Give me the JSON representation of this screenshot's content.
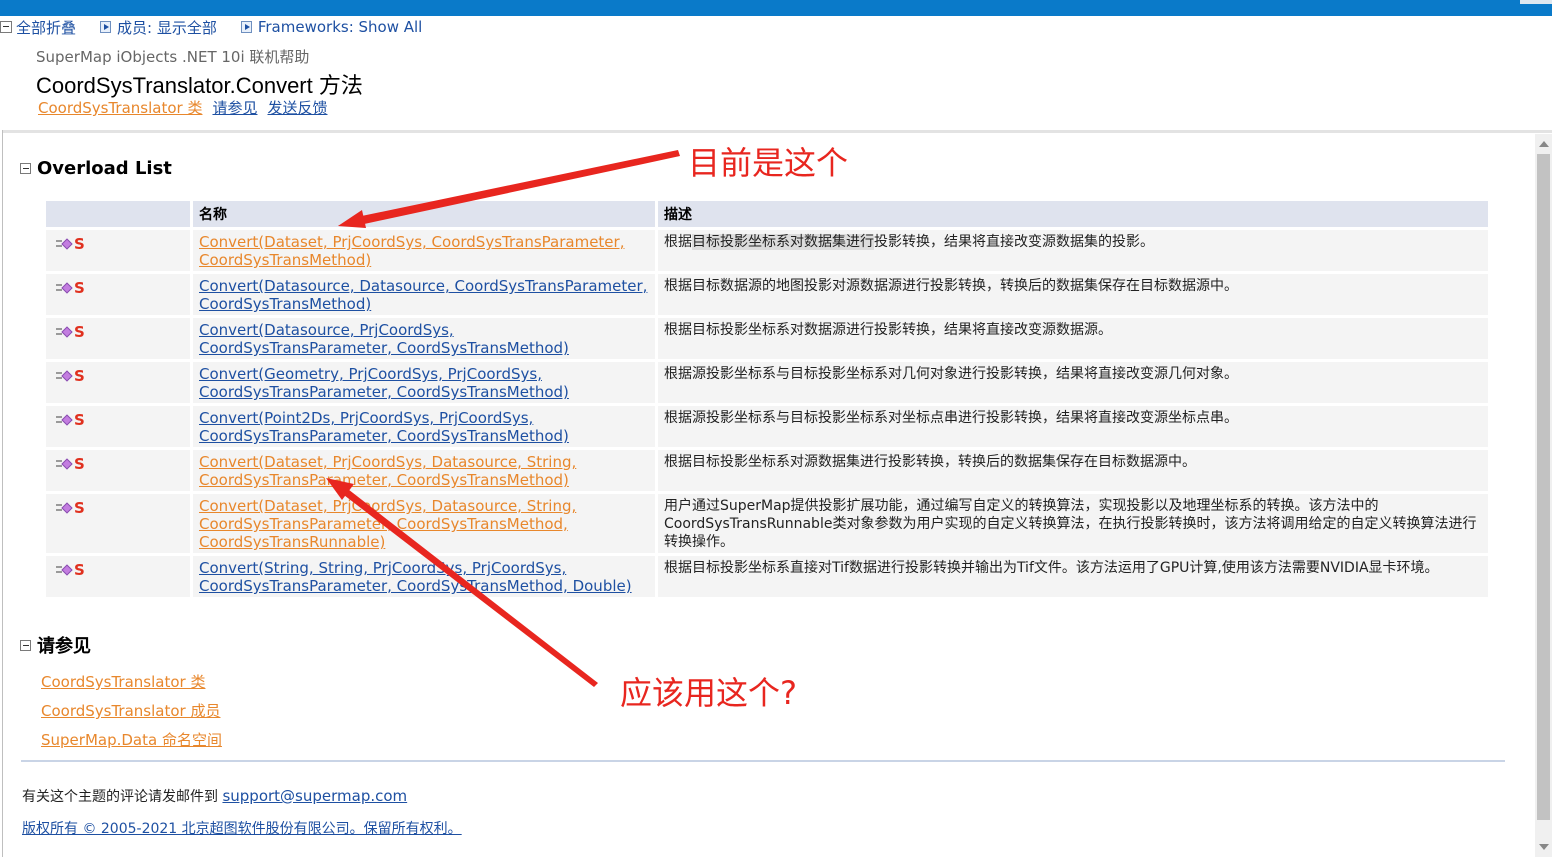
{
  "toolbar": {
    "collapse_all": "全部折叠",
    "members": "成员: 显示全部",
    "frameworks": "Frameworks: Show All"
  },
  "header": {
    "product": "SuperMap iObjects .NET 10i 联机帮助",
    "title": "CoordSysTranslator.Convert 方法",
    "links": [
      "CoordSysTranslator 类",
      "请参见",
      "发送反馈"
    ]
  },
  "overload_section": {
    "title": "Overload List",
    "col_name": "名称",
    "col_desc": "描述",
    "rows": [
      {
        "name_lines": [
          "Convert(Dataset, PrjCoordSys, CoordSysTransParameter,",
          "CoordSysTransMethod)"
        ],
        "visited": true,
        "desc_before": "根据",
        "desc_highlight": "目标投影坐标系对数据集进行",
        "desc_after": "投影转换，结果将直接改变源数据集的投影。"
      },
      {
        "name_lines": [
          "Convert(Datasource, Datasource, CoordSysTransParameter,",
          "CoordSysTransMethod)"
        ],
        "visited": false,
        "desc_before": "根据目标数据源的地图投影对源数据源进行投影转换，转换后的数据集保存在目标数据源中。",
        "desc_highlight": "",
        "desc_after": ""
      },
      {
        "name_lines": [
          "Convert(Datasource, PrjCoordSys,",
          "CoordSysTransParameter, CoordSysTransMethod)"
        ],
        "visited": false,
        "desc_before": "根据目标投影坐标系对数据源进行投影转换，结果将直接改变源数据源。",
        "desc_highlight": "",
        "desc_after": ""
      },
      {
        "name_lines": [
          "Convert(Geometry, PrjCoordSys, PrjCoordSys,",
          "CoordSysTransParameter, CoordSysTransMethod)"
        ],
        "visited": false,
        "desc_before": "根据源投影坐标系与目标投影坐标系对几何对象进行投影转换，结果将直接改变源几何对象。",
        "desc_highlight": "",
        "desc_after": ""
      },
      {
        "name_lines": [
          "Convert(Point2Ds, PrjCoordSys, PrjCoordSys,",
          "CoordSysTransParameter, CoordSysTransMethod)"
        ],
        "visited": false,
        "desc_before": "根据源投影坐标系与目标投影坐标系对坐标点串进行投影转换，结果将直接改变源坐标点串。",
        "desc_highlight": "",
        "desc_after": ""
      },
      {
        "name_lines": [
          "Convert(Dataset, PrjCoordSys, Datasource, String,",
          "CoordSysTransParameter, CoordSysTransMethod)"
        ],
        "visited": true,
        "desc_before": "根据目标投影坐标系对源数据集进行投影转换，转换后的数据集保存在目标数据源中。",
        "desc_highlight": "",
        "desc_after": ""
      },
      {
        "name_lines": [
          "Convert(Dataset, PrjCoordSys, Datasource, String,",
          "CoordSysTransParameter, CoordSysTransMethod,",
          "CoordSysTransRunnable)"
        ],
        "visited": true,
        "desc_before": "用户通过SuperMap提供投影扩展功能，通过编写自定义的转换算法，实现投影以及地理坐标系的转换。该方法中的CoordSysTransRunnable类对象参数为用户实现的自定义转换算法，在执行投影转换时，该方法将调用给定的自定义转换算法进行转换操作。",
        "desc_highlight": "",
        "desc_after": ""
      },
      {
        "name_lines": [
          "Convert(String, String, PrjCoordSys, PrjCoordSys,",
          "CoordSysTransParameter, CoordSysTransMethod, Double)"
        ],
        "visited": false,
        "desc_before": "根据目标投影坐标系直接对Tif数据进行投影转换并输出为Tif文件。该方法运用了GPU计算,使用该方法需要NVIDIA显卡环境。",
        "desc_highlight": "",
        "desc_after": ""
      }
    ]
  },
  "see_also": {
    "title": "请参见",
    "links": [
      "CoordSysTranslator 类",
      "CoordSysTranslator 成员",
      "SuperMap.Data 命名空间"
    ]
  },
  "footer": {
    "comment_text": "有关这个主题的评论请发邮件到",
    "email": "support@supermap.com",
    "copyright": "版权所有 © 2005-2021 北京超图软件股份有限公司。保留所有权利。"
  },
  "annotations": {
    "current": "目前是这个",
    "should_use": "应该用这个?",
    "color": "#e8261f"
  },
  "colors": {
    "topbar": "#0a7ac9",
    "link_blue": "#1e50a2",
    "link_visited": "#e8872c",
    "header_cell": "#dfe3ee",
    "row_cell": "#f4f4f4"
  }
}
